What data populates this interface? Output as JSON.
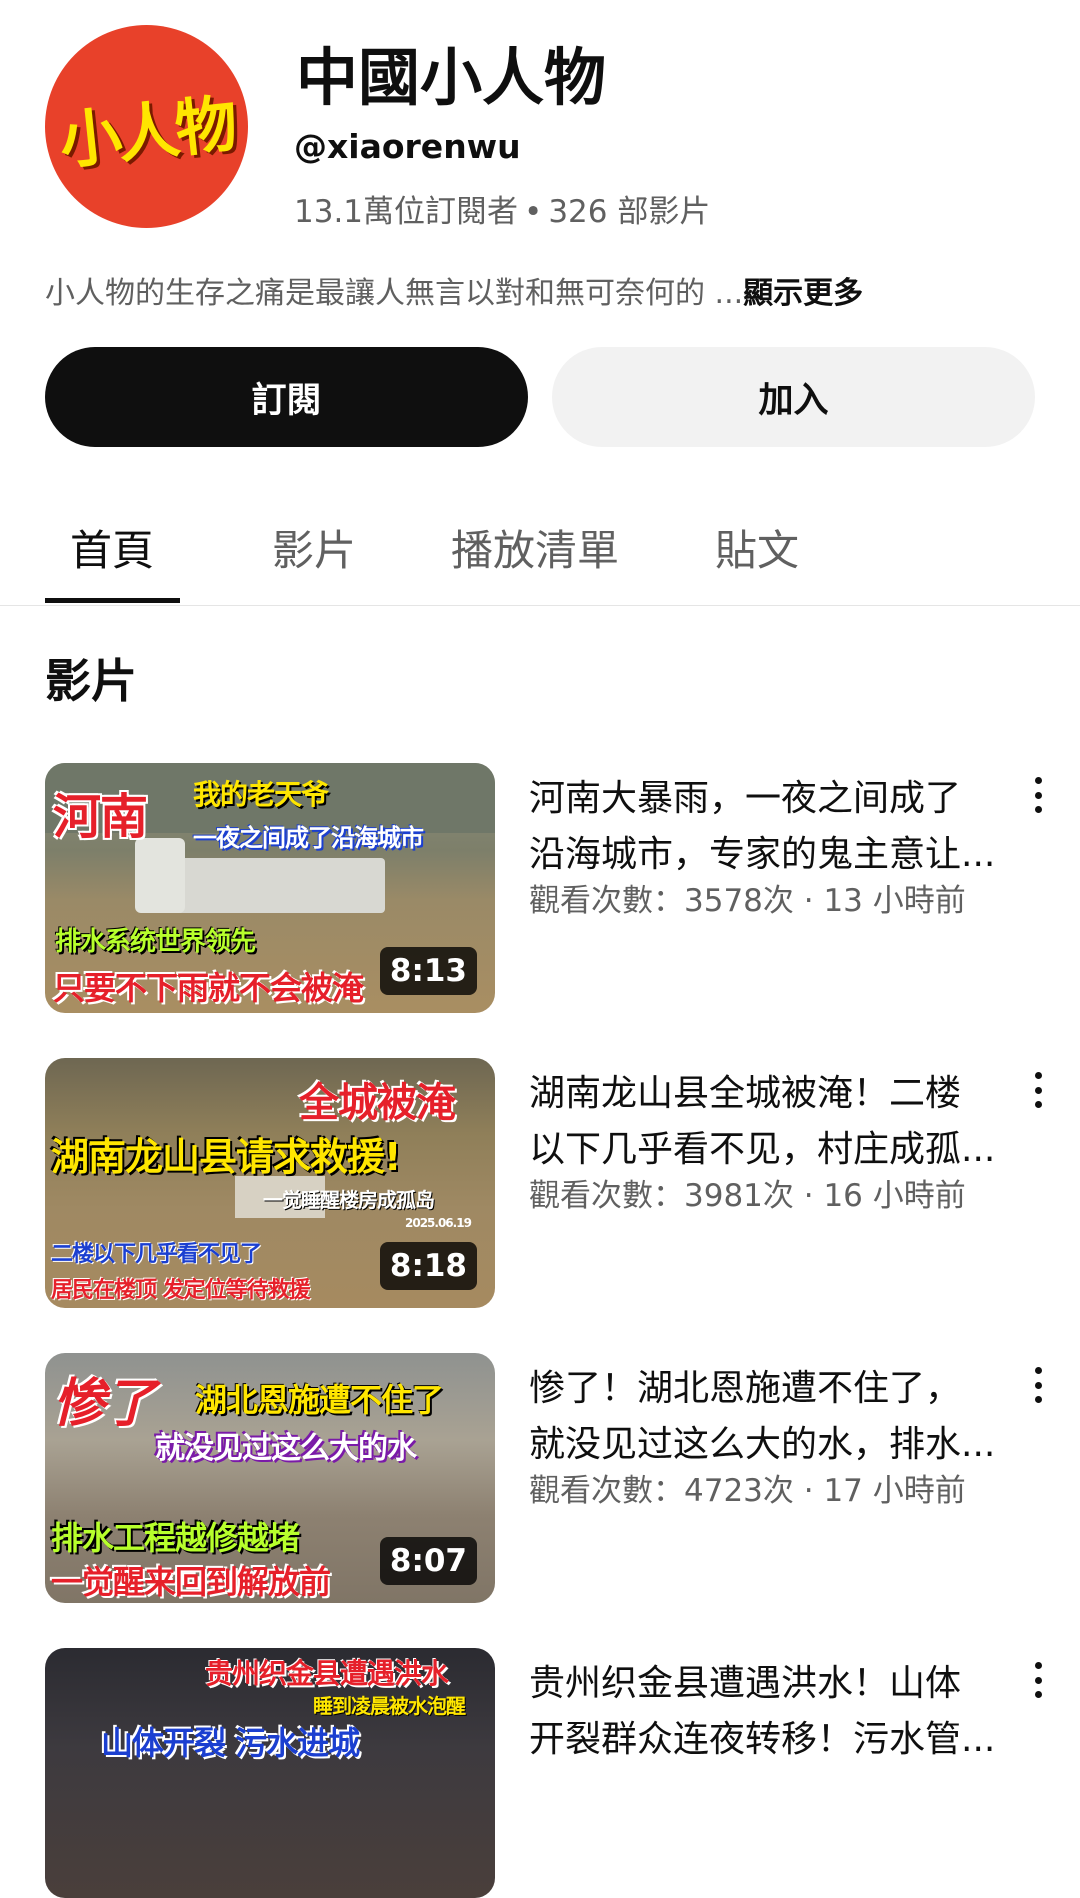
{
  "channel": {
    "avatar_text": "小人物",
    "name": "中國小人物",
    "handle": "@xiaorenwu",
    "subscribers": "13.1萬位訂閱者",
    "separator": "•",
    "videos_count": "326 部影片",
    "description": "小人物的生存之痛是最讓人無言以對和無可奈何的 ...",
    "more_label": "顯示更多"
  },
  "actions": {
    "subscribe_label": "訂閱",
    "join_label": "加入"
  },
  "tabs": [
    {
      "label": "首頁",
      "active": true
    },
    {
      "label": "影片",
      "active": false
    },
    {
      "label": "播放清單",
      "active": false
    },
    {
      "label": "貼文",
      "active": false
    }
  ],
  "section": {
    "title": "影片"
  },
  "videos": [
    {
      "title_line1": "河南大暴雨，一夜之间成了",
      "title_line2": "沿海城市，专家的鬼主意让...",
      "meta": "觀看次數：3578次 · 13 小時前",
      "duration": "8:13",
      "thumb_captions": [
        "河南",
        "我的老天爷",
        "一夜之间成了沿海城市",
        "排水系统世界领先",
        "只要不下雨就不会被淹"
      ]
    },
    {
      "title_line1": "湖南龙山县全城被淹！二楼",
      "title_line2": "以下几乎看不见，村庄成孤...",
      "meta": "觀看次數：3981次 · 16 小時前",
      "duration": "8:18",
      "thumb_captions": [
        "全城被淹",
        "湖南龙山县请求救援!",
        "一觉睡醒楼房成孤岛",
        "2025.06.19",
        "二楼以下几乎看不见了",
        "居民在楼顶 发定位等待救援"
      ]
    },
    {
      "title_line1": "惨了！湖北恩施遭不住了，",
      "title_line2": "就没见过这么大的水，排水...",
      "meta": "觀看次數：4723次 · 17 小時前",
      "duration": "8:07",
      "thumb_captions": [
        "惨了",
        "湖北恩施遭不住了",
        "就没见过这么大的水",
        "排水工程越修越堵",
        "一觉醒来回到解放前"
      ]
    },
    {
      "title_line1": "贵州织金县遭遇洪水！山体",
      "title_line2": "开裂群众连夜转移！污水管...",
      "meta": "",
      "duration": "",
      "thumb_captions": [
        "贵州织金县遭遇洪水",
        "睡到凌晨被水泡醒",
        "山体开裂 污水进城"
      ]
    }
  ],
  "colors": {
    "primary_text": "#0f0f0f",
    "secondary_text": "#606060",
    "subscribe_bg": "#0f0f0f",
    "join_bg": "#f2f2f2",
    "avatar_bg": "#e8412a",
    "avatar_text": "#ffe600"
  },
  "icons": {
    "more_options": "kebab-vertical-icon"
  }
}
